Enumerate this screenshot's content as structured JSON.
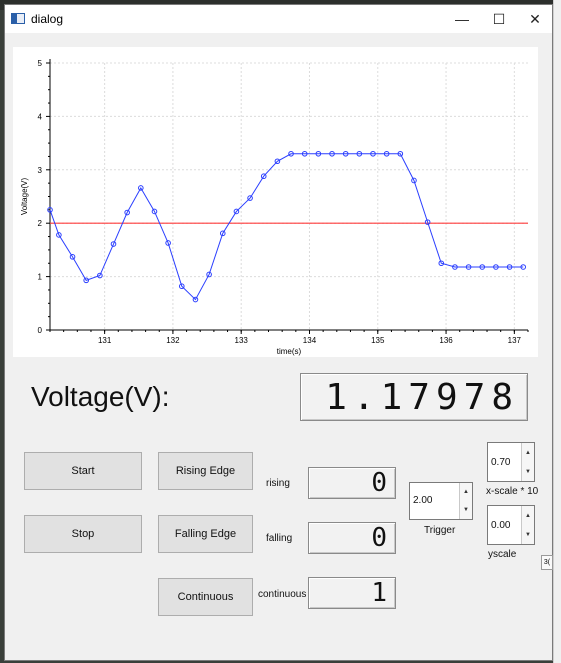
{
  "window": {
    "title": "dialog",
    "minimize": "—",
    "maximize": "☐",
    "close": "✕"
  },
  "chart_data": {
    "type": "line",
    "xlabel": "time(s)",
    "ylabel": "Voltage(V)",
    "xlim": [
      130.2,
      137.2
    ],
    "ylim": [
      0,
      5
    ],
    "x_ticks": [
      "131",
      "132",
      "133",
      "134",
      "135",
      "136",
      "137"
    ],
    "y_ticks": [
      "0",
      "1",
      "2",
      "3",
      "4",
      "5"
    ],
    "grid": true,
    "series": [
      {
        "x": [
          130.2,
          130.33,
          130.53,
          130.73,
          130.93,
          131.13,
          131.33,
          131.53,
          131.73,
          131.93,
          132.13,
          132.33,
          132.53,
          132.73,
          132.93,
          133.13,
          133.33,
          133.53,
          133.73,
          133.93,
          134.13,
          134.33,
          134.53,
          134.73,
          134.93,
          135.13,
          135.33,
          135.53,
          135.73,
          135.93,
          136.13,
          136.33,
          136.53,
          136.73,
          136.93,
          137.13
        ],
        "y": [
          2.25,
          1.78,
          1.37,
          0.93,
          1.02,
          1.61,
          2.2,
          2.66,
          2.22,
          1.63,
          0.82,
          0.57,
          1.04,
          1.81,
          2.22,
          2.47,
          2.88,
          3.16,
          3.3,
          3.3,
          3.3,
          3.3,
          3.3,
          3.3,
          3.3,
          3.3,
          3.3,
          2.8,
          2.02,
          1.25,
          1.18,
          1.18,
          1.18,
          1.18,
          1.18,
          1.18
        ],
        "color": "#2b3fff"
      }
    ],
    "threshold": {
      "y": 2.0,
      "color": "#ff3b3b"
    }
  },
  "display": {
    "label": "Voltage(V):",
    "value": "1.17978"
  },
  "buttons": {
    "start": "Start",
    "stop": "Stop",
    "rising": "Rising Edge",
    "falling": "Falling Edge",
    "continuous": "Continuous"
  },
  "counters": {
    "rising_label": "rising",
    "rising_value": "0",
    "falling_label": "falling",
    "falling_value": "0",
    "continuous_label": "continuous",
    "continuous_value": "1"
  },
  "controls": {
    "trigger_value": "2.00",
    "trigger_label": "Trigger",
    "xscale_value": "0.70",
    "xscale_label": "x-scale * 10",
    "yscale_value": "0.00",
    "yscale_label": "yscale"
  },
  "edge_widget": "3(",
  "colors": {
    "line": "#2b3fff",
    "threshold": "#ff3b3b"
  }
}
